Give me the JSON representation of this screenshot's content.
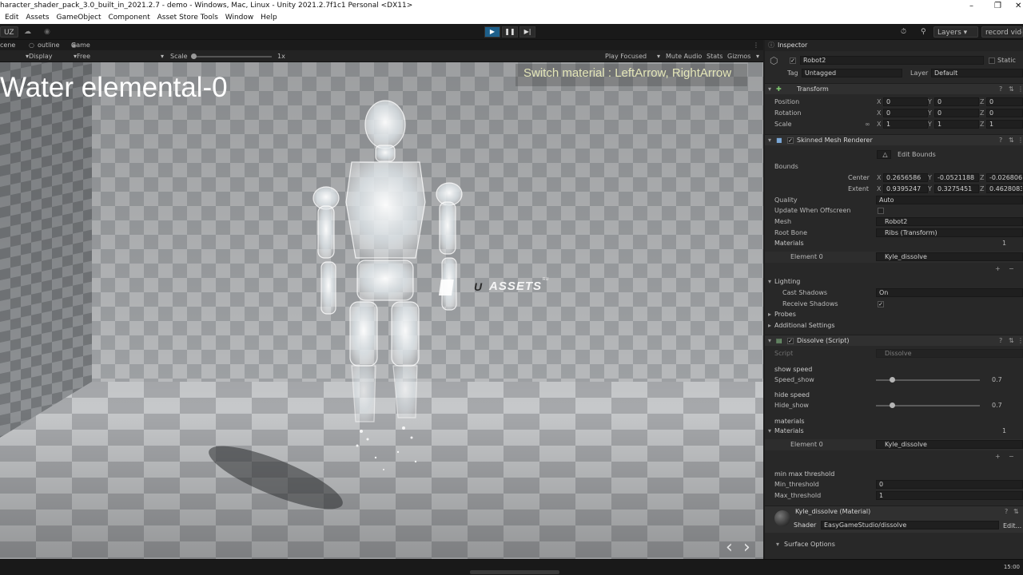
{
  "window": {
    "title": "haracter_shader_pack_3.0_built_in_2021.2.7 - demo - Windows, Mac, Linux - Unity 2021.2.7f1c1 Personal <DX11>"
  },
  "menu": [
    "Edit",
    "Assets",
    "GameObject",
    "Component",
    "Asset Store Tools",
    "Window",
    "Help"
  ],
  "toolbar": {
    "account": "UZ",
    "layers": "Layers",
    "record": "record video"
  },
  "tabs": {
    "scene": "cene",
    "outline": "outline",
    "game": "Game"
  },
  "gamebar": {
    "display": "Display 1",
    "aspect": "Free Aspect",
    "scale_label": "Scale",
    "scale_value": "1x",
    "play_focused": "Play Focused",
    "mute": "Mute Audio",
    "stats": "Stats",
    "gizmos": "Gizmos"
  },
  "overlay": {
    "title": "Water elemental-0",
    "hint": "Switch material : LeftArrow, RightArrow",
    "watermark": "ASSETS",
    "watermark_u": "U",
    "watermark_sup": "RU"
  },
  "inspector": {
    "tab": "Inspector",
    "object": {
      "name": "Robot2",
      "static": "Static",
      "tag_label": "Tag",
      "tag": "Untagged",
      "layer_label": "Layer",
      "layer": "Default"
    },
    "transform": {
      "title": "Transform",
      "rows": [
        {
          "label": "Position",
          "x": "0",
          "y": "0",
          "z": "0"
        },
        {
          "label": "Rotation",
          "x": "0",
          "y": "0",
          "z": "0"
        },
        {
          "label": "Scale",
          "x": "1",
          "y": "1",
          "z": "1"
        }
      ]
    },
    "smr": {
      "title": "Skinned Mesh Renderer",
      "edit_bounds": "Edit Bounds",
      "bounds": "Bounds",
      "center": {
        "label": "Center",
        "x": "0.2656586",
        "y": "-0.0521188",
        "z": "-0.026806"
      },
      "extent": {
        "label": "Extent",
        "x": "0.9395247",
        "y": "0.3275451",
        "z": "0.4628083"
      },
      "quality_label": "Quality",
      "quality": "Auto",
      "update_offscreen": "Update When Offscreen",
      "mesh_label": "Mesh",
      "mesh": "Robot2",
      "root_bone_label": "Root Bone",
      "root_bone": "Ribs (Transform)",
      "materials_label": "Materials",
      "materials_count": "1",
      "element0_label": "Element 0",
      "element0": "Kyle_dissolve",
      "lighting": "Lighting",
      "cast_shadows_label": "Cast Shadows",
      "cast_shadows": "On",
      "receive_shadows": "Receive Shadows",
      "probes": "Probes",
      "additional": "Additional Settings"
    },
    "dissolve": {
      "title": "Dissolve (Script)",
      "script_label": "Script",
      "script": "Dissolve",
      "show_speed": "show speed",
      "speed_show_label": "Speed_show",
      "speed_show": "0.7",
      "speed_show_frac": 0.7,
      "hide_speed": "hide speed",
      "hide_show_label": "Hide_show",
      "hide_show": "0.7",
      "hide_show_frac": 0.7,
      "materials_header": "materials",
      "materials_label": "Materials",
      "materials_count": "1",
      "element0_label": "Element 0",
      "element0": "Kyle_dissolve",
      "threshold_header": "min max threshold",
      "min_label": "Min_threshold",
      "min": "0",
      "max_label": "Max_threshold",
      "max": "1"
    },
    "material": {
      "name": "Kyle_dissolve (Material)",
      "shader_label": "Shader",
      "shader": "EasyGameStudio/dissolve",
      "edit": "Edit..."
    },
    "surface": "Surface Options"
  },
  "clock": "15:00"
}
